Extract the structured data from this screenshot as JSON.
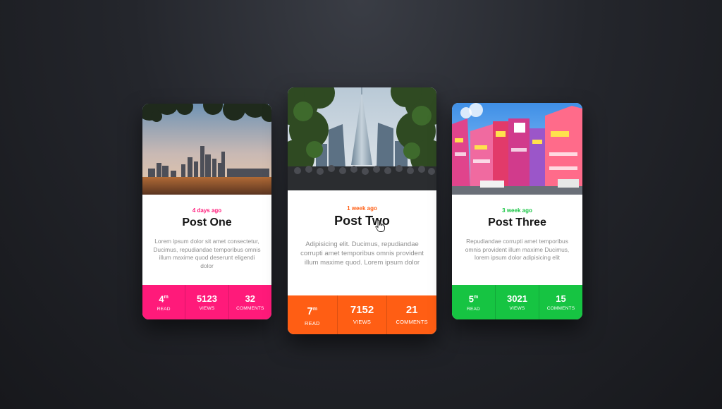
{
  "colors": {
    "background": "#24262c",
    "card_one_accent": "#ff1a7a",
    "card_two_accent": "#ff5e14",
    "card_three_accent": "#16c442"
  },
  "cards": [
    {
      "time": "4 days ago",
      "title": "Post One",
      "excerpt": "Lorem ipsum dolor sit amet consectetur, Ducimus, repudiandae temporibus omnis illum maxime quod deserunt eligendi dolor",
      "image": "city-skyline-photo",
      "stats": [
        {
          "value": "4",
          "sup": "m",
          "label": "READ"
        },
        {
          "value": "5123",
          "sup": "",
          "label": "VIEWS"
        },
        {
          "value": "32",
          "sup": "",
          "label": "COMMENTS"
        }
      ]
    },
    {
      "time": "1 week ago",
      "title": "Post Two",
      "excerpt": "Adipisicing elit. Ducimus, repudiandae corrupti amet temporibus omnis provident illum maxime quod. Lorem ipsum dolor",
      "image": "skyscraper-crowd-photo",
      "stats": [
        {
          "value": "7",
          "sup": "m",
          "label": "READ"
        },
        {
          "value": "7152",
          "sup": "",
          "label": "VIEWS"
        },
        {
          "value": "21",
          "sup": "",
          "label": "COMMENTS"
        }
      ]
    },
    {
      "time": "3 week ago",
      "title": "Post Three",
      "excerpt": "Repudiandae corrupti amet temporibus omnis provident illum maxime Ducimus, lorem ipsum dolor adipisicing elit",
      "image": "akihabara-street-photo",
      "stats": [
        {
          "value": "5",
          "sup": "m",
          "label": "READ"
        },
        {
          "value": "3021",
          "sup": "",
          "label": "VIEWS"
        },
        {
          "value": "15",
          "sup": "",
          "label": "COMMENTS"
        }
      ]
    }
  ]
}
